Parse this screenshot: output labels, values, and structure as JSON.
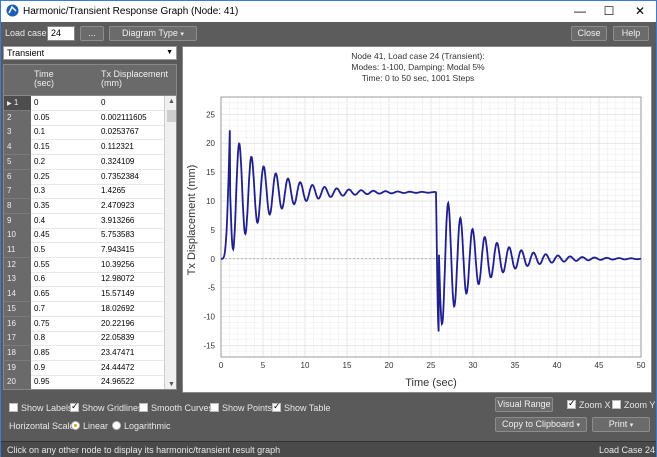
{
  "window": {
    "title": "Harmonic/Transient Response Graph (Node: 41)",
    "minimize": "—",
    "maximize": "☐",
    "close": "✕"
  },
  "toolbar": {
    "load_case_label": "Load case:",
    "load_case_value": "24",
    "browse_label": "...",
    "diagram_type_label": "Diagram Type",
    "close_label": "Close",
    "help_label": "Help"
  },
  "mode_combo": {
    "selected": "Transient"
  },
  "table": {
    "col_time": [
      "Time",
      "(sec)"
    ],
    "col_disp": [
      "Tx Displacement",
      "(mm)"
    ],
    "rows": [
      [
        "1",
        "0",
        "0"
      ],
      [
        "2",
        "0.05",
        "0.002111605"
      ],
      [
        "3",
        "0.1",
        "0.0253767"
      ],
      [
        "4",
        "0.15",
        "0.112321"
      ],
      [
        "5",
        "0.2",
        "0.324109"
      ],
      [
        "6",
        "0.25",
        "0.7352384"
      ],
      [
        "7",
        "0.3",
        "1.4265"
      ],
      [
        "8",
        "0.35",
        "2.470923"
      ],
      [
        "9",
        "0.4",
        "3.913266"
      ],
      [
        "10",
        "0.45",
        "5.753583"
      ],
      [
        "11",
        "0.5",
        "7.943415"
      ],
      [
        "12",
        "0.55",
        "10.39256"
      ],
      [
        "13",
        "0.6",
        "12.98072"
      ],
      [
        "14",
        "0.65",
        "15.57149"
      ],
      [
        "15",
        "0.7",
        "18.02692"
      ],
      [
        "16",
        "0.75",
        "20.22196"
      ],
      [
        "17",
        "0.8",
        "22.05839"
      ],
      [
        "18",
        "0.85",
        "23.47471"
      ],
      [
        "19",
        "0.9",
        "24.44472"
      ],
      [
        "20",
        "0.95",
        "24.96522"
      ]
    ]
  },
  "chart_header": {
    "line1": "Node 41, Load case 24 (Transient):",
    "line2": "Modes: 1-100, Damping: Modal 5%",
    "line3": "Time: 0 to 50 sec, 1001 Steps"
  },
  "chart_data": {
    "type": "line",
    "xlabel": "Time (sec)",
    "ylabel": "Tx Displacement (mm)",
    "xlim": [
      0,
      50
    ],
    "ylim": [
      -17,
      28
    ],
    "xticks": [
      "0",
      "5",
      "10",
      "15",
      "20",
      "25",
      "30",
      "35",
      "40",
      "45",
      "50"
    ],
    "yticks": [
      "-15",
      "-10",
      "-5",
      "0",
      "5",
      "10",
      "15",
      "20",
      "25"
    ],
    "grid": true,
    "series": [
      {
        "color": "#1f1f8f",
        "model": "forced-then-free damped oscillation",
        "static_level": 11.5,
        "first_peak": 25,
        "period_sec": 1.45,
        "release_time": 25.6,
        "release_min": -13.2
      }
    ]
  },
  "options": {
    "show_labels": "Show Labels",
    "show_gridlines": "Show Gridlines",
    "smooth_curves": "Smooth Curves",
    "show_points": "Show Points",
    "show_table": "Show Table",
    "horizontal_scale": "Horizontal Scale:",
    "linear": "Linear",
    "logarithmic": "Logarithmic",
    "visual_range": "Visual Range",
    "zoom_x": "Zoom X",
    "zoom_y": "Zoom Y",
    "copy_clipboard": "Copy to Clipboard",
    "print": "Print"
  },
  "status": {
    "left": "Click on any other node to display its harmonic/transient result graph",
    "right": "Load Case 24"
  },
  "colors": {
    "curve": "#1f1f8f",
    "accent": "#3a7bd5",
    "radio": "#e6a020"
  }
}
